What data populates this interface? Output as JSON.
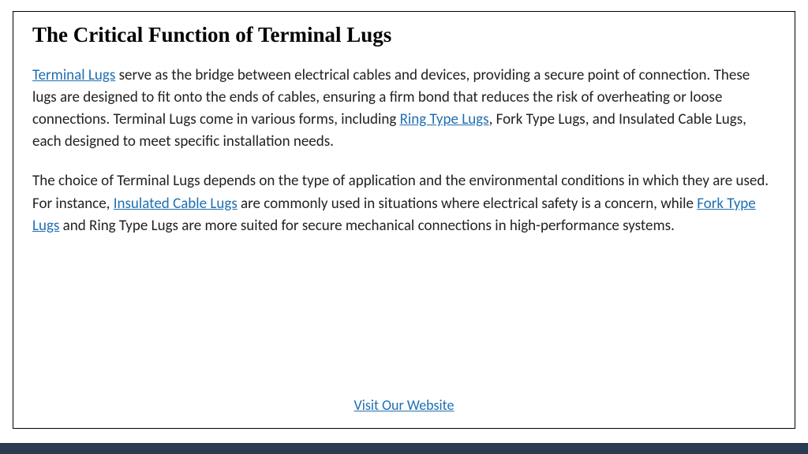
{
  "heading": "The Critical Function of Terminal Lugs",
  "links": {
    "terminal_lugs": "Terminal Lugs",
    "ring_type_lugs": "Ring Type Lugs",
    "insulated_cable_lugs": "Insulated Cable Lugs",
    "fork_type_lugs": "Fork Type Lugs",
    "visit": "Visit Our Website"
  },
  "para1": {
    "seg1": " serve as the bridge between electrical cables and devices, providing a secure point of connection. These lugs are designed to fit onto the ends of cables, ensuring a firm bond that reduces the risk of overheating or loose connections. Terminal Lugs come in various forms, including ",
    "seg2": ", Fork Type Lugs, and Insulated Cable Lugs, each designed to meet specific installation needs."
  },
  "para2": {
    "seg1": "The choice of Terminal Lugs depends on the type of application and the environmental conditions in which they are used. For instance, ",
    "seg2": " are commonly used in situations where electrical safety is a concern, while ",
    "seg3": " and Ring Type Lugs are more suited for secure mechanical connections in high-performance systems."
  }
}
